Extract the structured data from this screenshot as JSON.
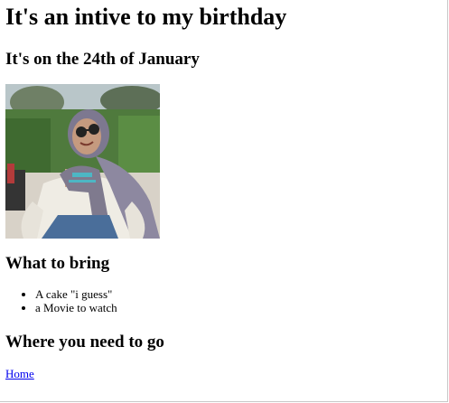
{
  "page": {
    "title": "It's an intive to my birthday",
    "subtitle": "It's on the 24th of January",
    "bring_heading": "What to bring",
    "bring_items": [
      "A cake \"i guess\"",
      "a Movie to watch"
    ],
    "where_heading": "Where you need to go",
    "home_link": "Home"
  },
  "colors": {
    "link": "#0000ee",
    "text": "#000000",
    "background": "#ffffff"
  }
}
